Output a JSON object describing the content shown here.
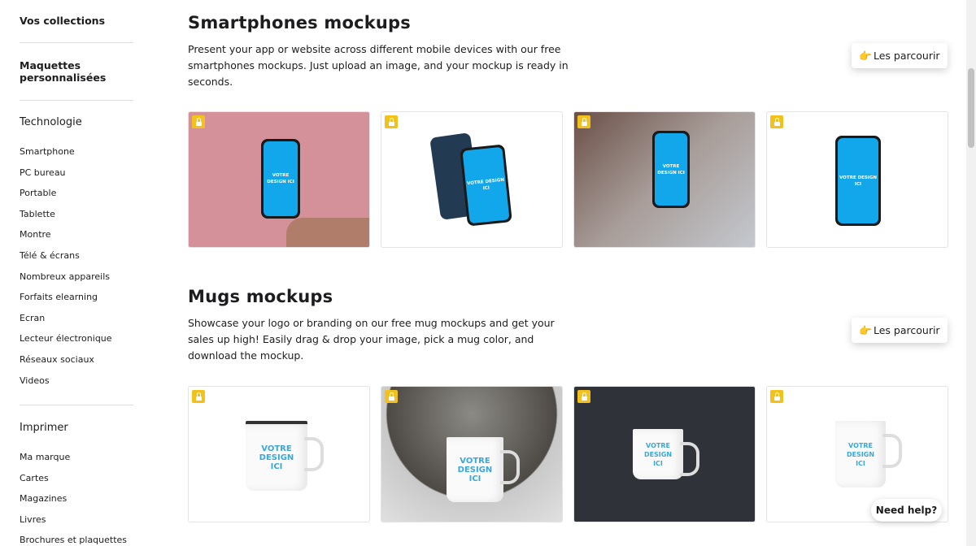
{
  "sidebar": {
    "collections": "Vos collections",
    "custom": "Maquettes personnalisées",
    "tech_heading": "Technologie",
    "tech_items": [
      "Smartphone",
      "PC bureau",
      "Portable",
      "Tablette",
      "Montre",
      "Télé & écrans",
      "Nombreux appareils",
      "Forfaits elearning",
      "Ecran",
      "Lecteur électronique",
      "Réseaux sociaux",
      "Videos"
    ],
    "print_heading": "Imprimer",
    "print_items": [
      "Ma marque",
      "Cartes",
      "Magazines",
      "Livres",
      "Brochures et plaquettes"
    ]
  },
  "sections": [
    {
      "title": "Smartphones mockups",
      "description": "Present your app or website across different mobile devices with our free smartphones mockups. Just upload an image, and your mockup is ready in seconds.",
      "browse": "Les parcourir",
      "browse_icon": "pointing-hand-icon"
    },
    {
      "title": "Mugs mockups",
      "description": "Showcase your logo or branding on our free mug mockups and get your sales up high! Easily drag & drop your image, pick a mug color, and download the mockup.",
      "browse": "Les parcourir",
      "browse_icon": "pointing-hand-icon"
    }
  ],
  "placeholder": "VOTRE DESIGN ICI",
  "badge_icon": "unlocked-padlock-icon",
  "badge_color": "#f2c11b",
  "screen_color": "#12a6ea",
  "help": "Need help?"
}
